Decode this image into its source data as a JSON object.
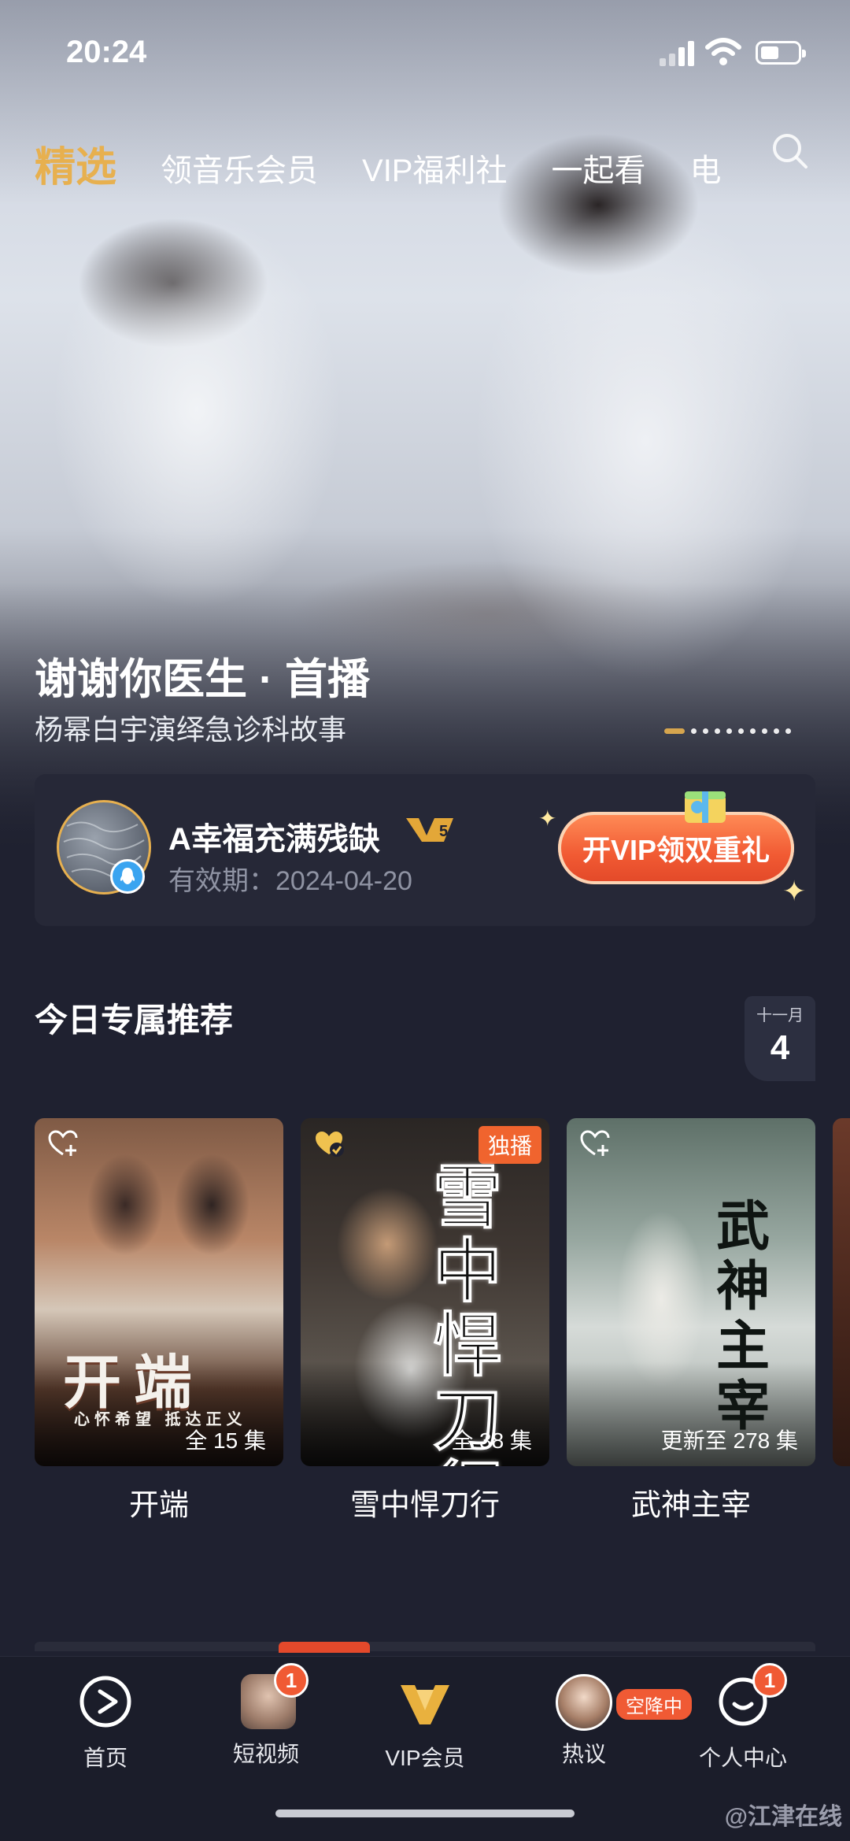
{
  "status_bar": {
    "time": "20:24"
  },
  "tabs": [
    {
      "label": "精选",
      "active": true
    },
    {
      "label": "领音乐会员"
    },
    {
      "label": "VIP福利社"
    },
    {
      "label": "一起看"
    },
    {
      "label": "电"
    }
  ],
  "hero": {
    "title": "谢谢你医生 · 首播",
    "subtitle": "杨幂白宇演绎急诊科故事",
    "slides_total": 10,
    "slide_active": 1
  },
  "vip_card": {
    "username": "A幸福充满残缺",
    "level_badge": "V5",
    "expiry_label": "有效期：",
    "expiry_date": "2024-04-20",
    "cta": "开VIP领双重礼"
  },
  "section": {
    "title": "今日专属推荐",
    "calendar_month": "十一月",
    "calendar_day": "4"
  },
  "posters": [
    {
      "name": "开端",
      "episodes": "全 15 集",
      "art_title": "开端",
      "art_tagline": "心怀希望 抵达正义"
    },
    {
      "name": "雪中悍刀行",
      "episodes": "全 38 集",
      "tag": "独播",
      "art_title": "雪中悍刀行"
    },
    {
      "name": "武神主宰",
      "episodes": "更新至 278 集",
      "art_title": "武神主宰"
    }
  ],
  "bottom_nav": [
    {
      "label": "首页",
      "icon": "play-logo-icon"
    },
    {
      "label": "短视频",
      "icon": "short-video-thumb",
      "badge": "1"
    },
    {
      "label": "VIP会员",
      "icon": "vip-crown-icon"
    },
    {
      "label": "热议",
      "icon": "hot-talk-avatar",
      "pill": "空降中"
    },
    {
      "label": "个人中心",
      "icon": "smile-icon",
      "badge": "1"
    }
  ],
  "watermark": "@江津在线",
  "colors": {
    "accent": "#e7b04f",
    "cta": "#f15a33",
    "background": "#1f2130"
  }
}
